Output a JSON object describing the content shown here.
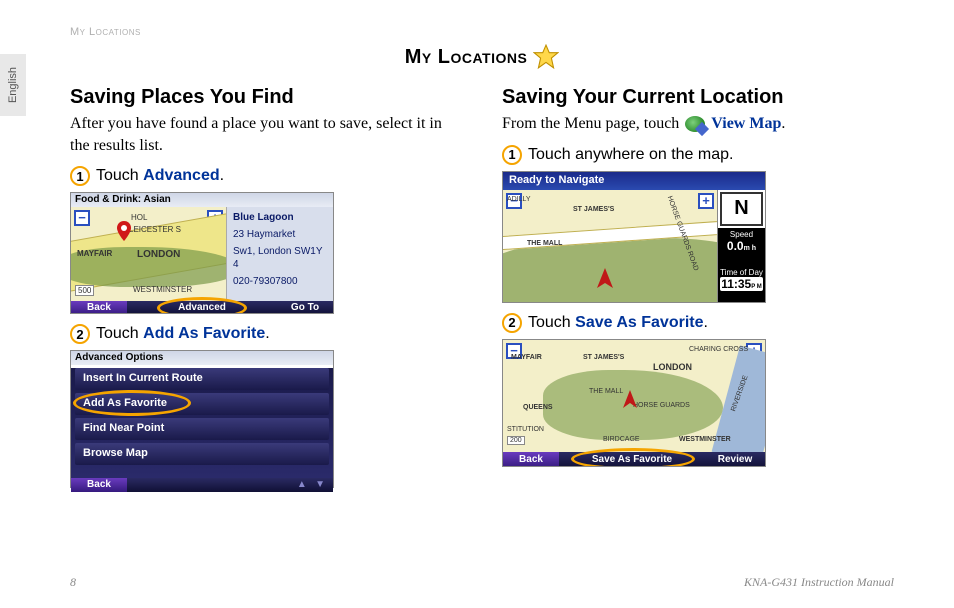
{
  "header_label": "My Locations",
  "lang_tab": "English",
  "page_title": "My Locations",
  "left": {
    "heading": "Saving Places You Find",
    "intro": "After you have found a place you want to save, select it in the results list.",
    "step1_prefix": "Touch ",
    "step1_link": "Advanced",
    "step1_suffix": ".",
    "step2_prefix": "Touch ",
    "step2_link": "Add As Favorite",
    "step2_suffix": ".",
    "sc1": {
      "top": "Food & Drink: Asian",
      "place_name": "Blue Lagoon",
      "addr1": "23 Haymarket",
      "addr2": "Sw1, London SW1Y 4",
      "addr3": "020-79307800",
      "map_labels": [
        "HOL",
        "LEICESTER S",
        "MAYFAIR",
        "LONDON",
        "WESTMINSTER",
        "500"
      ],
      "btn_back": "Back",
      "btn_advanced": "Advanced",
      "btn_goto": "Go To"
    },
    "sc2": {
      "top": "Advanced Options",
      "items": [
        "Insert In Current Route",
        "Add As Favorite",
        "Find Near Point",
        "Browse Map"
      ],
      "btn_back": "Back"
    }
  },
  "right": {
    "heading": "Saving Your Current Location",
    "intro_prefix": "From the Menu page, touch ",
    "intro_link": "View Map",
    "intro_suffix": ".",
    "step1": "Touch anywhere on the map.",
    "step2_prefix": "Touch ",
    "step2_link": "Save As Favorite",
    "step2_suffix": ".",
    "sc3": {
      "top": "Ready to Navigate",
      "north": "N",
      "speed_label": "Speed",
      "speed_value": "0.0",
      "speed_unit": "m h",
      "time_label": "Time of Day",
      "time_value": "11:35",
      "time_suffix": "P M",
      "map_labels": [
        "ADILLY",
        "ST JAMES'S",
        "THE MALL",
        "HORSE GUARDS ROAD"
      ]
    },
    "sc4": {
      "map_labels": [
        "MAYFAIR",
        "ST JAMES'S",
        "LONDON",
        "CHARING CROSS",
        "QUEENS",
        "THE MALL",
        "HORSE GUARDS",
        "STITUTION",
        "200",
        "BIRDCAGE",
        "WESTMINSTER",
        "RIVERSIDE"
      ],
      "btn_back": "Back",
      "btn_save": "Save As Favorite",
      "btn_review": "Review"
    }
  },
  "footer": {
    "page": "8",
    "manual": "KNA-G431 Instruction Manual"
  }
}
